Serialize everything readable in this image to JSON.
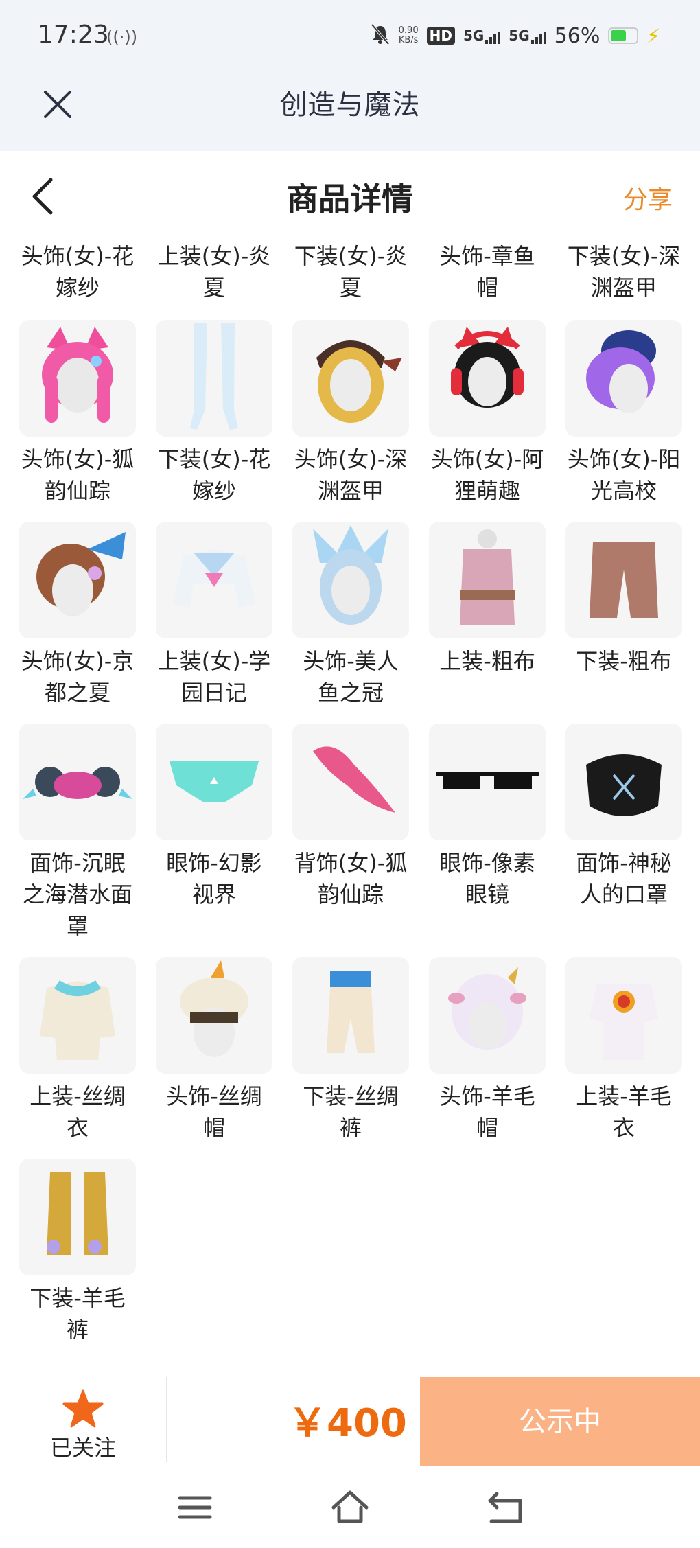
{
  "status_bar": {
    "time": "17:23",
    "net_speed_value": "0.90",
    "net_speed_unit": "KB/s",
    "hd_label": "HD",
    "signal1_label": "5G",
    "signal2_label": "5G",
    "battery_percent": "56%",
    "battery_level": 0.56
  },
  "app_header": {
    "title": "创造与魔法",
    "close_icon": "close-icon"
  },
  "nav": {
    "title": "商品详情",
    "share_label": "分享",
    "back_icon": "back-arrow-icon"
  },
  "top_row_labels": [
    "头饰(女)-花嫁纱",
    "上装(女)-炎夏",
    "下装(女)-炎夏",
    "头饰-章鱼帽",
    "下装(女)-深渊盔甲"
  ],
  "items": [
    "头饰(女)-狐韵仙踪",
    "下装(女)-花嫁纱",
    "头饰(女)-深渊盔甲",
    "头饰(女)-阿狸萌趣",
    "头饰(女)-阳光高校",
    "头饰(女)-京都之夏",
    "上装(女)-学园日记",
    "头饰-美人鱼之冠",
    "上装-粗布",
    "下装-粗布",
    "面饰-沉眠之海潜水面罩",
    "眼饰-幻影视界",
    "背饰(女)-狐韵仙踪",
    "眼饰-像素眼镜",
    "面饰-神秘人的口罩",
    "上装-丝绸衣",
    "头饰-丝绸帽",
    "下装-丝绸裤",
    "头饰-羊毛帽",
    "上装-羊毛衣",
    "下装-羊毛裤"
  ],
  "bottom_bar": {
    "follow_label": "已关注",
    "price": "￥400",
    "status_button": "公示中"
  },
  "colors": {
    "accent_orange": "#ee6a0e",
    "share_orange": "#e88a2a",
    "status_button_bg": "#fbb385",
    "header_bg": "#f1f4f8"
  }
}
